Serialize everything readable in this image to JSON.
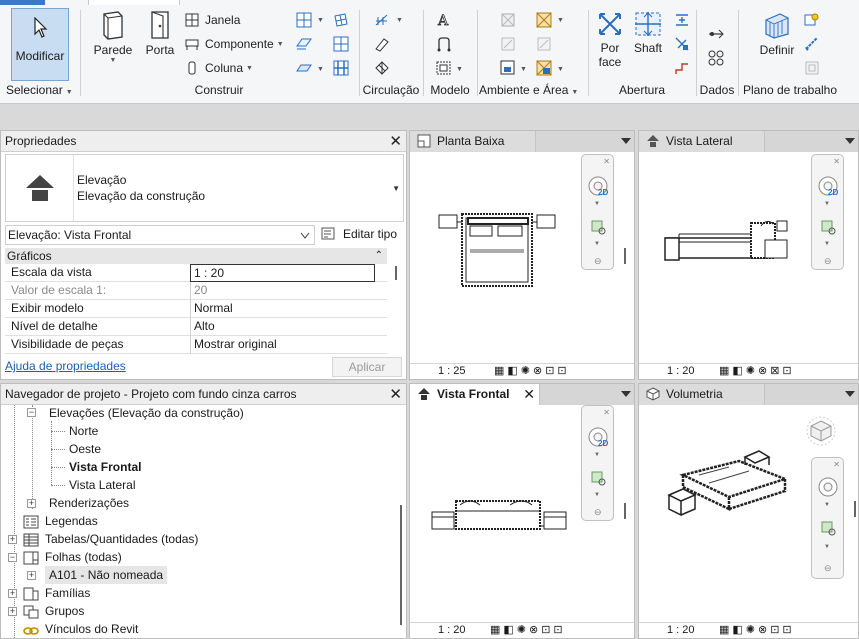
{
  "ribbon": {
    "modify_label": "Modificar",
    "select_label": "Selecionar",
    "build": {
      "wall": "Parede",
      "door": "Porta",
      "window": "Janela",
      "component": "Componente",
      "column": "Coluna",
      "panel_label": "Construir"
    },
    "circulation_label": "Circulação",
    "model_label": "Modelo",
    "room_area_label": "Ambiente e Área",
    "opening": {
      "by_face": "Por\nface",
      "by_face_l1": "Por",
      "by_face_l2": "face",
      "shaft": "Shaft",
      "panel_label": "Abertura"
    },
    "datum_label": "Dados",
    "workplane": {
      "set": "Definir",
      "panel_label": "Plano de trabalho"
    }
  },
  "properties": {
    "title": "Propriedades",
    "type_line1": "Elevação",
    "type_line2": "Elevação da construção",
    "instance_selector": "Elevação: Vista Frontal",
    "edit_type": "Editar tipo",
    "group_graphics": "Gráficos",
    "rows": [
      {
        "key": "Escala da vista",
        "value": "1 : 20"
      },
      {
        "key": "Valor de escala    1:",
        "value": "20"
      },
      {
        "key": "Exibir modelo",
        "value": "Normal"
      },
      {
        "key": "Nível de detalhe",
        "value": "Alto"
      },
      {
        "key": "Visibilidade de peças",
        "value": "Mostrar original"
      }
    ],
    "help_link": "Ajuda de propriedades",
    "apply": "Aplicar"
  },
  "browser": {
    "title": "Navegador de projeto - Projeto com fundo cinza carros",
    "items": [
      {
        "label": "Elevações (Elevação da construção)"
      },
      {
        "label": "Norte"
      },
      {
        "label": "Oeste"
      },
      {
        "label": "Vista Frontal"
      },
      {
        "label": "Vista Lateral"
      },
      {
        "label": "Renderizações"
      },
      {
        "label": "Legendas"
      },
      {
        "label": "Tabelas/Quantidades (todas)"
      },
      {
        "label": "Folhas (todas)"
      },
      {
        "label": "A101 - Não nomeada"
      },
      {
        "label": "Famílias"
      },
      {
        "label": "Grupos"
      },
      {
        "label": "Vínculos do Revit"
      }
    ]
  },
  "views": {
    "plan": {
      "tab": "Planta Baixa",
      "scale": "1 : 25"
    },
    "side": {
      "tab": "Vista Lateral",
      "scale": "1 : 20"
    },
    "front": {
      "tab": "Vista Frontal",
      "scale": "1 : 20"
    },
    "threed": {
      "tab": "Volumetria",
      "scale": "1 : 20"
    },
    "nav_2d": "2D"
  },
  "colors": {
    "accent": "#3c78c8",
    "modify_bg": "#c8dcf2",
    "link": "#1a5fb4"
  }
}
